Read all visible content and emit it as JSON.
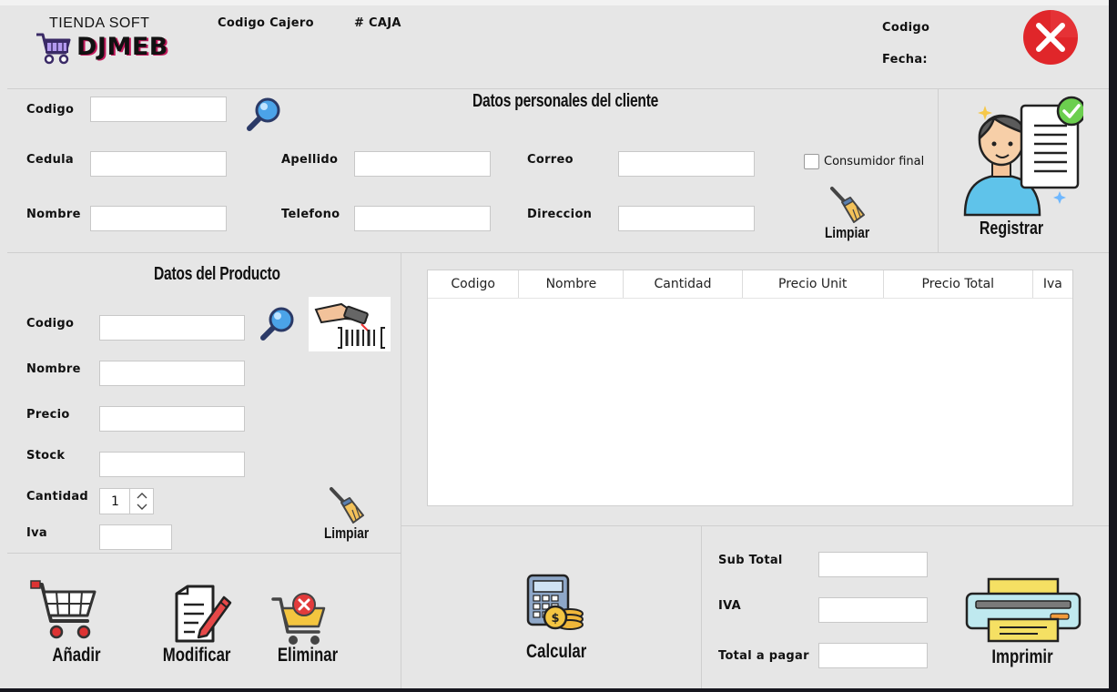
{
  "header": {
    "brand_top": "TIENDA SOFT",
    "brand_main": "DJMEB",
    "codigo_cajero": "Codigo Cajero",
    "caja": "# CAJA",
    "codigo": "Codigo",
    "fecha": "Fecha:"
  },
  "cliente": {
    "title": "Datos personales del cliente",
    "codigo": "Codigo",
    "cedula": "Cedula",
    "nombre": "Nombre",
    "apellido": "Apellido",
    "telefono": "Telefono",
    "correo": "Correo",
    "direccion": "Direccion",
    "consumidor_final": "Consumidor final",
    "limpiar": "Limpiar",
    "registrar": "Registrar"
  },
  "producto": {
    "title": "Datos del Producto",
    "codigo": "Codigo",
    "nombre": "Nombre",
    "precio": "Precio",
    "stock": "Stock",
    "cantidad": "Cantidad",
    "cantidad_value": "1",
    "iva": "Iva",
    "limpiar": "Limpiar"
  },
  "table": {
    "columns": [
      "Codigo",
      "Nombre",
      "Cantidad",
      "Precio Unit",
      "Precio Total",
      "Iva"
    ]
  },
  "actions": {
    "anadir": "Añadir",
    "modificar": "Modificar",
    "eliminar": "Eliminar",
    "calcular": "Calcular",
    "imprimir": "Imprimir"
  },
  "totals": {
    "subtotal": "Sub Total",
    "iva": "IVA",
    "total": "Total a pagar"
  },
  "colors": {
    "window_bg": "#e6e6e6",
    "close_red": "#e0262a",
    "brand_purple": "#7a4fd6"
  }
}
